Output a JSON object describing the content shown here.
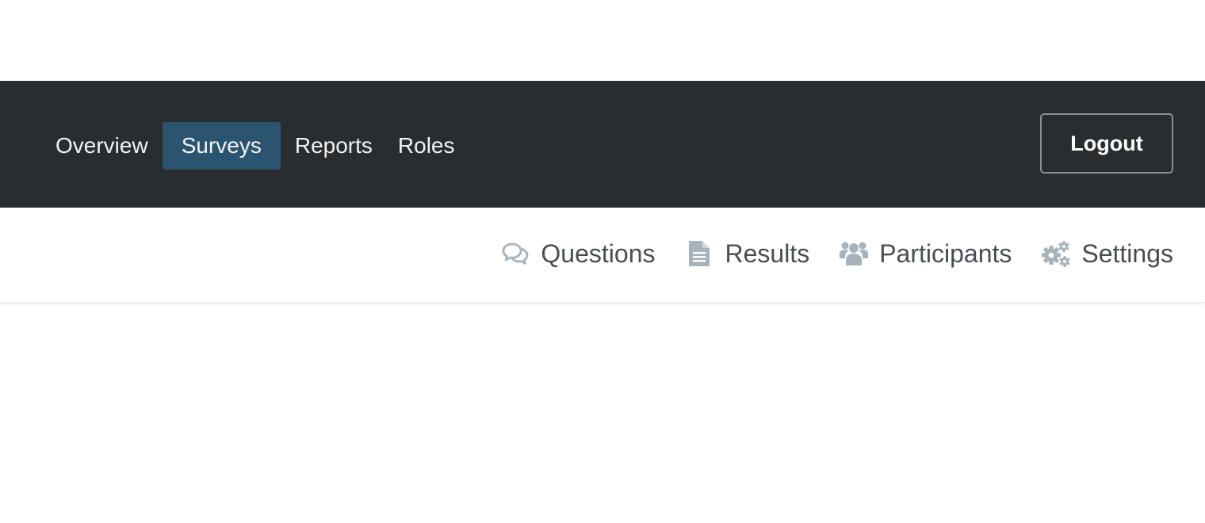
{
  "navbar": {
    "items": [
      {
        "label": "Overview",
        "active": false
      },
      {
        "label": "Surveys",
        "active": true
      },
      {
        "label": "Reports",
        "active": false
      },
      {
        "label": "Roles",
        "active": false
      }
    ],
    "logout_label": "Logout",
    "background": "#2a2d30",
    "active_color": "#2b5470"
  },
  "subnav": {
    "items": [
      {
        "label": "Questions",
        "icon": "comments-icon"
      },
      {
        "label": "Results",
        "icon": "document-icon"
      },
      {
        "label": "Participants",
        "icon": "users-icon"
      },
      {
        "label": "Settings",
        "icon": "gears-icon"
      }
    ],
    "icon_color": "#a8b2ba",
    "text_color": "#484d52"
  }
}
